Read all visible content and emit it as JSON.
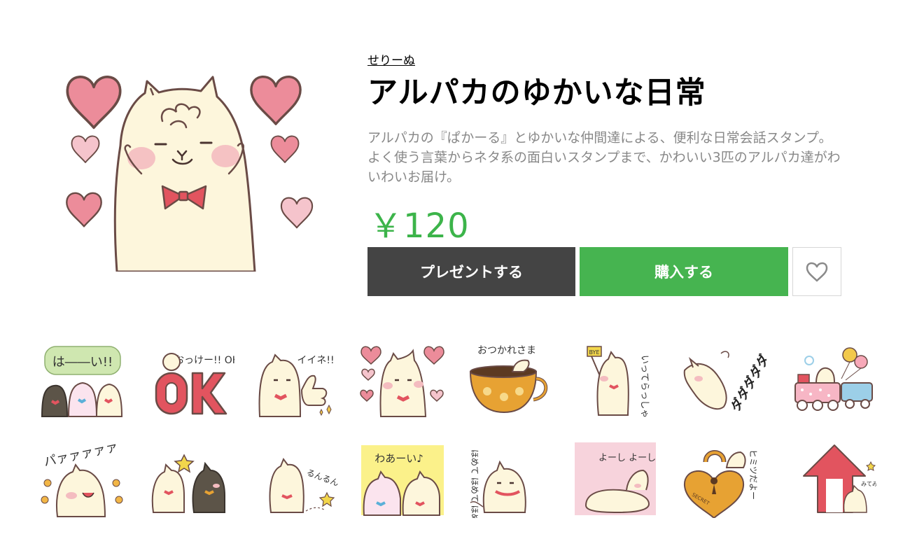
{
  "sticker": {
    "author": "せりーぬ",
    "title": "アルパカのゆかいな日常",
    "description": "アルパカの『ぱかーる』とゆかいな仲間達による、便利な日常会話スタンプ。よく使う言葉からネタ系の面白いスタンプまで、かわいい3匹のアルパカ達がわいわいお届け。",
    "price": "￥120"
  },
  "actions": {
    "gift_label": "プレゼントする",
    "buy_label": "購入する",
    "favorite_icon": "heart-outline-icon"
  },
  "colors": {
    "price": "#3cb44a",
    "buy": "#46b450",
    "gift": "#444444",
    "description": "#888888"
  },
  "stickers": {
    "row1": [
      {
        "id": "hai",
        "text": "は――い!!"
      },
      {
        "id": "ok",
        "text": "おっけー!! OK"
      },
      {
        "id": "iine",
        "text": "イイネ!!"
      },
      {
        "id": "hearts",
        "text": ""
      },
      {
        "id": "otsukaresama",
        "text": "おつかれさま"
      },
      {
        "id": "itterasshai",
        "text": "いってらっしゃい"
      },
      {
        "id": "dadada",
        "text": "ダダダダダ"
      },
      {
        "id": "train",
        "text": ""
      }
    ],
    "row2": [
      {
        "id": "paaa",
        "text": "パァァァァァ"
      },
      {
        "id": "stars",
        "text": ""
      },
      {
        "id": "runrun",
        "text": "るんるん"
      },
      {
        "id": "waai",
        "text": "わあーい♪"
      },
      {
        "id": "homete",
        "text": "ほめて ほめて ほめて"
      },
      {
        "id": "yoshiyoshi",
        "text": "よーし よーし"
      },
      {
        "id": "himitsu",
        "text": "ヒミツだよー"
      },
      {
        "id": "arrow",
        "text": "みてみて"
      }
    ]
  }
}
